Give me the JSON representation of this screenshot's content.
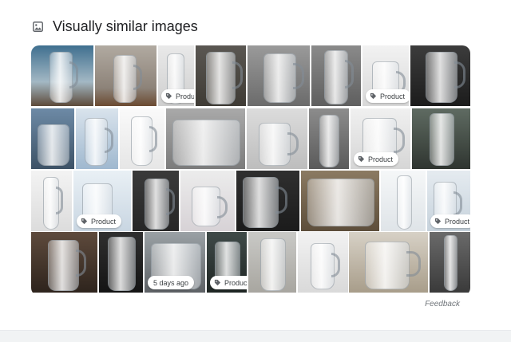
{
  "header": {
    "title": "Visually similar images",
    "icon": "image-icon"
  },
  "badges": {
    "product": "Product",
    "time": "5 days ago"
  },
  "feedback": "Feedback",
  "colors": {
    "text": "#202124",
    "muted": "#70757a",
    "badge_bg": "#ffffff"
  },
  "rows": [
    [
      {
        "name": "pitcher-blue-background"
      },
      {
        "name": "glass-pitcher-wood-table"
      },
      {
        "name": "glass-carafe",
        "badge": "product"
      },
      {
        "name": "etched-pitcher-dark"
      },
      {
        "name": "clear-water-jug"
      },
      {
        "name": "claret-jug-silver-lid"
      },
      {
        "name": "glass-pitcher-white",
        "badge": "product"
      },
      {
        "name": "crystal-pitcher-dark-backdrop"
      }
    ],
    [
      {
        "name": "blue-glassware-set"
      },
      {
        "name": "blue-tinted-pitcher"
      },
      {
        "name": "cut-glass-pitcher-white"
      },
      {
        "name": "painted-tumblers"
      },
      {
        "name": "pitcher-with-orange-swirl"
      },
      {
        "name": "glass-carafe-gray"
      },
      {
        "name": "pressed-glass-pitcher",
        "badge": "product"
      },
      {
        "name": "green-vase"
      }
    ],
    [
      {
        "name": "claret-jug-white"
      },
      {
        "name": "glass-tumblers-blue",
        "badge": "product"
      },
      {
        "name": "cut-glass-pitcher-table"
      },
      {
        "name": "pitcher-pink-glasses"
      },
      {
        "name": "water-set-dark"
      },
      {
        "name": "glassware-set-brown"
      },
      {
        "name": "tall-clear-vase"
      },
      {
        "name": "glass-tumblers",
        "badge": "product"
      }
    ],
    [
      {
        "name": "silver-rim-pitcher"
      },
      {
        "name": "crystal-vase-dark"
      },
      {
        "name": "glass-set-window",
        "badge": "time"
      },
      {
        "name": "green-glasses",
        "badge": "product"
      },
      {
        "name": "stoneware-jug"
      },
      {
        "name": "branded-glass-jug"
      },
      {
        "name": "etched-pitcher-table"
      },
      {
        "name": "tall-bud-vase"
      }
    ]
  ]
}
